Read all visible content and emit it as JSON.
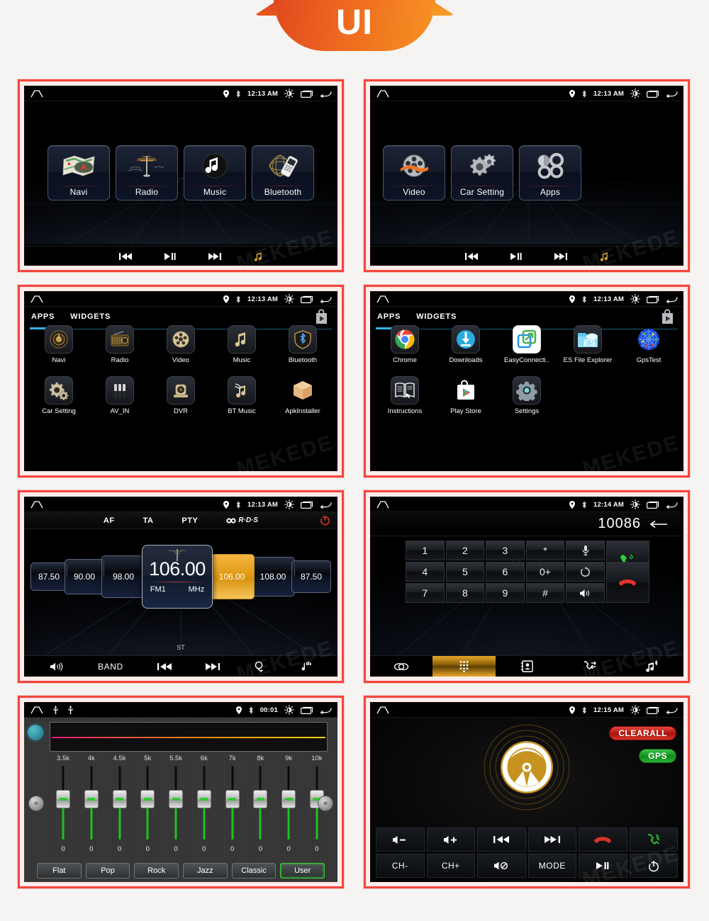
{
  "banner": {
    "text": "UI"
  },
  "watermark": "MEKEDE",
  "colors": {
    "frame_border": "#f4453e",
    "accent_blue": "#33b5e5",
    "accent_amber": "#e09a14",
    "green": "#1fc21f",
    "red": "#d8342b"
  },
  "panels": [
    {
      "id": "home-page-1",
      "name": "Home Page 1",
      "statusbar": {
        "time": "12:13 AM",
        "icons": [
          "home-icon",
          "location-icon",
          "bluetooth-icon",
          "brightness-icon",
          "recents-icon",
          "back-icon"
        ]
      },
      "tiles": [
        {
          "label": "Navi",
          "icon": "map-icon"
        },
        {
          "label": "Radio",
          "icon": "radio-antenna-icon"
        },
        {
          "label": "Music",
          "icon": "music-note-icon"
        },
        {
          "label": "Bluetooth",
          "icon": "bluetooth-phone-icon"
        }
      ],
      "mediabar": [
        "previous-icon",
        "play-pause-icon",
        "next-icon",
        "music-icon"
      ]
    },
    {
      "id": "home-page-2",
      "name": "Home Page 2",
      "statusbar": {
        "time": "12:13 AM"
      },
      "tiles": [
        {
          "label": "Video",
          "icon": "film-reel-icon"
        },
        {
          "label": "Car Setting",
          "icon": "gears-icon"
        },
        {
          "label": "Apps",
          "icon": "apps-rings-icon"
        }
      ],
      "mediabar": [
        "previous-icon",
        "play-pause-icon",
        "next-icon",
        "music-icon"
      ]
    },
    {
      "id": "app-drawer-1",
      "name": "App Drawer Page 1",
      "statusbar": {
        "time": "12:13 AM"
      },
      "tabs": [
        {
          "label": "APPS",
          "active": true
        },
        {
          "label": "WIDGETS",
          "active": false
        }
      ],
      "store_icon": "play-store-bag-icon",
      "apps": [
        {
          "label": "Navi",
          "icon": "navi-compass-icon"
        },
        {
          "label": "Radio",
          "icon": "radio-icon"
        },
        {
          "label": "Video",
          "icon": "film-reel-icon"
        },
        {
          "label": "Music",
          "icon": "music-notes-icon"
        },
        {
          "label": "Bluetooth",
          "icon": "bluetooth-shield-icon"
        },
        {
          "label": "Car Setting",
          "icon": "gears-icon"
        },
        {
          "label": "AV_IN",
          "icon": "rca-plugs-icon"
        },
        {
          "label": "DVR",
          "icon": "dash-camera-icon"
        },
        {
          "label": "BT Music",
          "icon": "bt-music-icon"
        },
        {
          "label": "ApkInstaller",
          "icon": "box-icon"
        }
      ]
    },
    {
      "id": "app-drawer-2",
      "name": "App Drawer Page 2",
      "statusbar": {
        "time": "12:13 AM"
      },
      "tabs": [
        {
          "label": "APPS",
          "active": true
        },
        {
          "label": "WIDGETS",
          "active": false
        }
      ],
      "store_icon": "play-store-bag-icon",
      "apps": [
        {
          "label": "Chrome",
          "icon": "chrome-icon"
        },
        {
          "label": "Downloads",
          "icon": "download-icon"
        },
        {
          "label": "EasyConnecti..",
          "icon": "easyconnection-icon"
        },
        {
          "label": "ES File Explorer",
          "icon": "es-file-explorer-icon"
        },
        {
          "label": "GpsTest",
          "icon": "gps-radar-icon"
        },
        {
          "label": "Instructions",
          "icon": "book-icon"
        },
        {
          "label": "Play Store",
          "icon": "play-store-icon"
        },
        {
          "label": "Settings",
          "icon": "settings-gear-icon"
        }
      ]
    },
    {
      "id": "radio",
      "name": "Radio",
      "statusbar": {
        "time": "12:13 AM"
      },
      "toolbar": [
        "AF",
        "TA",
        "PTY"
      ],
      "rds_label": "R·D·S",
      "power_icon": "power-icon",
      "carousel": {
        "left": [
          "87.50",
          "90.00",
          "98.00"
        ],
        "current": "106.00",
        "band": "FM1",
        "unit": "MHz",
        "selected": "106.00",
        "right": [
          "108.00",
          "87.50"
        ]
      },
      "stereo_label": "ST",
      "bottombar": [
        {
          "label": "",
          "icon": "volume-icon"
        },
        {
          "label": "BAND",
          "icon": ""
        },
        {
          "label": "",
          "icon": "previous-icon"
        },
        {
          "label": "",
          "icon": "next-icon"
        },
        {
          "label": "",
          "icon": "search-scan-icon"
        },
        {
          "label": "",
          "icon": "eq-music-icon"
        }
      ]
    },
    {
      "id": "dialer",
      "name": "Bluetooth Dialer",
      "statusbar": {
        "time": "12:14 AM"
      },
      "dial_number": "10086",
      "backspace_icon": "backspace-arrow-icon",
      "keys": [
        "1",
        "2",
        "3",
        "*",
        "mic-icon",
        "4",
        "5",
        "6",
        "0+",
        "rotate-icon",
        "7",
        "8",
        "9",
        "#",
        "speaker-icon"
      ],
      "call_icon": "call-answer-icon",
      "hangup_icon": "call-end-icon",
      "tabs": [
        {
          "icon": "link-pair-icon",
          "active": false
        },
        {
          "icon": "dialpad-icon",
          "active": true
        },
        {
          "icon": "contacts-icon",
          "active": false
        },
        {
          "icon": "call-log-icon",
          "active": false
        },
        {
          "icon": "bt-music-note-icon",
          "active": false
        }
      ]
    },
    {
      "id": "equalizer",
      "name": "Equalizer",
      "statusbar": {
        "time": "00:01",
        "extra_icons": [
          "usb-icon",
          "usb-icon"
        ]
      },
      "bands": [
        "3.5k",
        "4k",
        "4.5k",
        "5k",
        "5.5k",
        "6k",
        "7k",
        "8k",
        "9k",
        "10k"
      ],
      "values": [
        "0",
        "0",
        "0",
        "0",
        "0",
        "0",
        "0",
        "0",
        "0",
        "0"
      ],
      "presets": [
        {
          "label": "Flat",
          "active": false
        },
        {
          "label": "Pop",
          "active": false
        },
        {
          "label": "Rock",
          "active": false
        },
        {
          "label": "Jazz",
          "active": false
        },
        {
          "label": "Classic",
          "active": false
        },
        {
          "label": "User",
          "active": true
        }
      ],
      "nav": {
        "prev": "«",
        "next": "»"
      }
    },
    {
      "id": "steering-wheel",
      "name": "Steering Wheel Control",
      "statusbar": {
        "time": "12:15 AM"
      },
      "wheel_icon": "steering-wheel-icon",
      "clear_button": "CLEARALL",
      "gps_button": "GPS",
      "buttons": [
        {
          "label": "",
          "icon": "volume-down-icon"
        },
        {
          "label": "",
          "icon": "volume-up-icon"
        },
        {
          "label": "",
          "icon": "previous-icon"
        },
        {
          "label": "",
          "icon": "next-icon"
        },
        {
          "label": "",
          "icon": "call-end-icon"
        },
        {
          "label": "",
          "icon": "call-answer-icon"
        },
        {
          "label": "CH-",
          "icon": ""
        },
        {
          "label": "CH+",
          "icon": ""
        },
        {
          "label": "",
          "icon": "mute-icon"
        },
        {
          "label": "MODE",
          "icon": ""
        },
        {
          "label": "",
          "icon": "play-pause-icon"
        },
        {
          "label": "",
          "icon": "power-icon"
        }
      ]
    }
  ]
}
